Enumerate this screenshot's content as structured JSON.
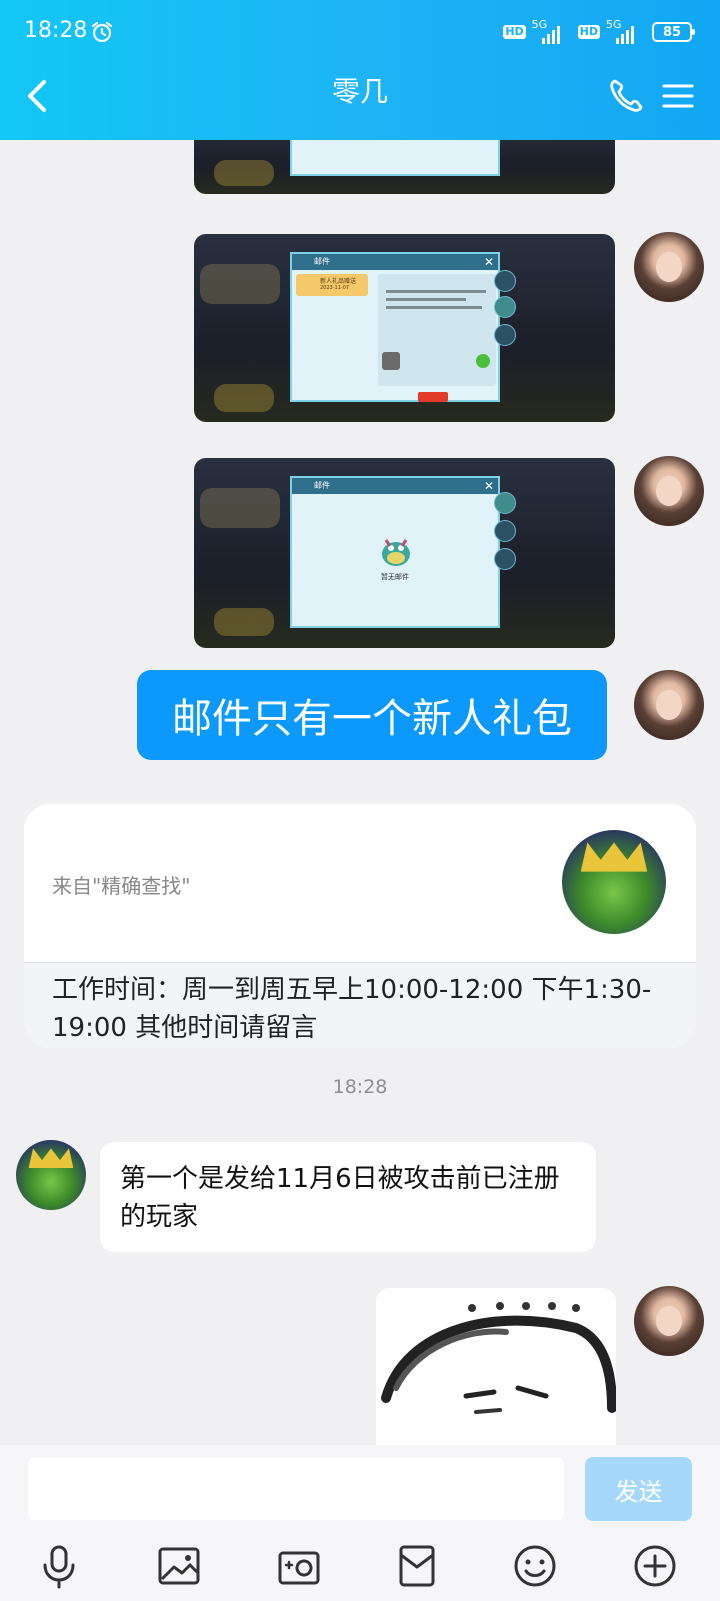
{
  "status_bar": {
    "time": "18:28",
    "hd": "HD",
    "network": "5G",
    "battery": "85"
  },
  "header": {
    "title": "零几"
  },
  "messages": {
    "text_me": "邮件只有一个新人礼包",
    "card_source": "来自\"精确查找\"",
    "card_notice": " 工作时间：周一到周五早上10:00-12:00 下午1:30-19:00 其他时间请留言",
    "time_separator": "18:28",
    "text_other": "第一个是发给11月6日被攻击前已注册的玩家"
  },
  "screenshot_texts": {
    "mail_title": "邮件",
    "gift_item": "新人礼品赠送",
    "gift_date": "2023-11-07",
    "empty_mail": "暂无邮件"
  },
  "input_bar": {
    "placeholder": "",
    "send_label": "发送"
  },
  "colors": {
    "header_start": "#12c7f6",
    "header_end": "#12a7f4",
    "bubble_me": "#0d98fb",
    "send_disabled": "#a6d8fb"
  },
  "icons": [
    "alarm-icon",
    "back-icon",
    "phone-icon",
    "menu-icon",
    "mic-icon",
    "image-icon",
    "camera-icon",
    "red-packet-icon",
    "emoji-icon",
    "plus-icon"
  ]
}
